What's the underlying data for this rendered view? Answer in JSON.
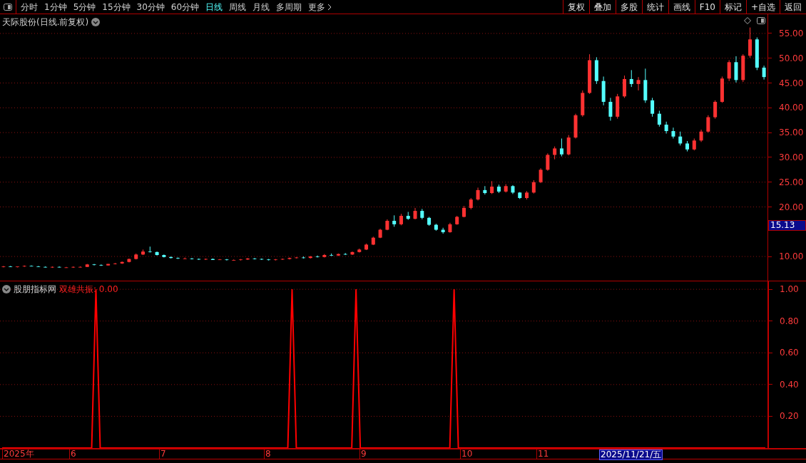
{
  "toolbar": {
    "periods": [
      {
        "label": "分时",
        "selected": false
      },
      {
        "label": "1分钟",
        "selected": false
      },
      {
        "label": "5分钟",
        "selected": false
      },
      {
        "label": "15分钟",
        "selected": false
      },
      {
        "label": "30分钟",
        "selected": false
      },
      {
        "label": "60分钟",
        "selected": false
      },
      {
        "label": "日线",
        "selected": true
      },
      {
        "label": "周线",
        "selected": false
      },
      {
        "label": "月线",
        "selected": false
      },
      {
        "label": "多周期",
        "selected": false
      }
    ],
    "more": "更多",
    "actions": [
      "复权",
      "叠加",
      "多股",
      "统计",
      "画线",
      "F10",
      "标记",
      "+自选",
      "返回"
    ]
  },
  "main_chart": {
    "title": "天际股份(日线.前复权)",
    "last_price": "15.13",
    "chart_data": {
      "type": "candlestick",
      "ylim": [
        5.13,
        58.87
      ],
      "grid": true,
      "yticks": [
        {
          "value": 55,
          "label": "55.00"
        },
        {
          "value": 50,
          "label": "50.00"
        },
        {
          "value": 45,
          "label": "45.00"
        },
        {
          "value": 40,
          "label": "40.00"
        },
        {
          "value": 35,
          "label": "35.00"
        },
        {
          "value": 30,
          "label": "30.00"
        },
        {
          "value": 25,
          "label": "25.00"
        },
        {
          "value": 20,
          "label": "20.00"
        },
        {
          "value": 10,
          "label": "10.00"
        }
      ],
      "categories": [
        null,
        null,
        null,
        null,
        null,
        null,
        null,
        null,
        null,
        null,
        null,
        null,
        null,
        null,
        null,
        null,
        null,
        null,
        null,
        null,
        null,
        null,
        null,
        null,
        null,
        null,
        null,
        null,
        null,
        null,
        null,
        null,
        null,
        null,
        null,
        null,
        null,
        null,
        null,
        null,
        null,
        null,
        null,
        null,
        null,
        null,
        null,
        null,
        null,
        null,
        null,
        null,
        null,
        null,
        null,
        null,
        null,
        null,
        null,
        null,
        null,
        null,
        null,
        null,
        null,
        null,
        null,
        null,
        null,
        null,
        null,
        null,
        null,
        null,
        null,
        null,
        null,
        null,
        null,
        null,
        null,
        null,
        null,
        null,
        null,
        null,
        null,
        null,
        null,
        null,
        null,
        null,
        null,
        null,
        null,
        null,
        null,
        null,
        null,
        null,
        null,
        null,
        null,
        null,
        null,
        null,
        null,
        null,
        null,
        null
      ],
      "ohlc": [
        [
          7.9,
          8.1,
          7.8,
          8.0
        ],
        [
          8.0,
          8.1,
          7.9,
          7.9
        ],
        [
          7.9,
          8.0,
          7.8,
          8.0
        ],
        [
          8.0,
          8.2,
          7.9,
          8.1
        ],
        [
          8.1,
          8.2,
          8.0,
          8.0
        ],
        [
          8.0,
          8.1,
          7.9,
          7.9
        ],
        [
          7.9,
          8.0,
          7.8,
          7.8
        ],
        [
          7.8,
          8.0,
          7.7,
          7.9
        ],
        [
          7.9,
          8.0,
          7.8,
          7.8
        ],
        [
          7.8,
          7.9,
          7.7,
          7.8
        ],
        [
          7.8,
          8.0,
          7.7,
          7.9
        ],
        [
          7.9,
          8.0,
          7.8,
          7.9
        ],
        [
          7.9,
          8.5,
          7.9,
          8.4
        ],
        [
          8.4,
          8.5,
          8.2,
          8.3
        ],
        [
          8.3,
          8.4,
          8.1,
          8.2
        ],
        [
          8.2,
          8.5,
          8.2,
          8.5
        ],
        [
          8.5,
          8.7,
          8.4,
          8.6
        ],
        [
          8.6,
          9.0,
          8.5,
          8.9
        ],
        [
          8.9,
          9.6,
          8.8,
          9.5
        ],
        [
          9.5,
          10.6,
          9.4,
          10.4
        ],
        [
          10.4,
          11.4,
          10.3,
          11.0
        ],
        [
          11.0,
          12.0,
          10.8,
          10.9
        ],
        [
          10.9,
          11.0,
          10.2,
          10.3
        ],
        [
          10.3,
          10.4,
          9.8,
          9.9
        ],
        [
          9.9,
          10.0,
          9.6,
          9.7
        ],
        [
          9.7,
          9.8,
          9.5,
          9.6
        ],
        [
          9.6,
          9.8,
          9.5,
          9.6
        ],
        [
          9.6,
          9.7,
          9.4,
          9.5
        ],
        [
          9.5,
          9.6,
          9.3,
          9.4
        ],
        [
          9.4,
          9.6,
          9.3,
          9.5
        ],
        [
          9.5,
          9.6,
          9.3,
          9.3
        ],
        [
          9.3,
          9.5,
          9.3,
          9.4
        ],
        [
          9.4,
          9.5,
          9.2,
          9.3
        ],
        [
          9.3,
          9.4,
          9.2,
          9.3
        ],
        [
          9.3,
          9.5,
          9.2,
          9.4
        ],
        [
          9.4,
          9.7,
          9.3,
          9.6
        ],
        [
          9.6,
          9.7,
          9.4,
          9.5
        ],
        [
          9.5,
          9.6,
          9.3,
          9.4
        ],
        [
          9.4,
          9.5,
          9.2,
          9.3
        ],
        [
          9.3,
          9.5,
          9.2,
          9.4
        ],
        [
          9.4,
          9.6,
          9.3,
          9.5
        ],
        [
          9.5,
          9.8,
          9.4,
          9.7
        ],
        [
          9.7,
          9.9,
          9.6,
          9.8
        ],
        [
          9.8,
          10.0,
          9.6,
          9.7
        ],
        [
          9.7,
          10.1,
          9.6,
          10.0
        ],
        [
          10.0,
          10.2,
          9.8,
          9.9
        ],
        [
          9.9,
          10.5,
          9.8,
          10.3
        ],
        [
          10.3,
          10.6,
          10.1,
          10.2
        ],
        [
          10.2,
          10.6,
          10.1,
          10.5
        ],
        [
          10.5,
          10.7,
          10.3,
          10.4
        ],
        [
          10.4,
          11.0,
          10.3,
          10.9
        ],
        [
          10.9,
          11.6,
          10.8,
          11.4
        ],
        [
          11.4,
          12.6,
          11.3,
          12.4
        ],
        [
          12.4,
          14.0,
          12.3,
          13.8
        ],
        [
          13.8,
          15.6,
          13.7,
          15.4
        ],
        [
          15.4,
          17.5,
          15.3,
          17.2
        ],
        [
          17.2,
          18.3,
          16.0,
          16.5
        ],
        [
          16.5,
          18.6,
          16.3,
          18.2
        ],
        [
          18.2,
          19.0,
          17.4,
          17.6
        ],
        [
          17.6,
          19.8,
          17.5,
          19.2
        ],
        [
          19.2,
          19.6,
          17.5,
          17.8
        ],
        [
          17.8,
          18.0,
          16.2,
          16.4
        ],
        [
          16.4,
          16.6,
          15.2,
          15.4
        ],
        [
          15.4,
          15.8,
          14.6,
          14.9
        ],
        [
          14.9,
          16.8,
          14.8,
          16.5
        ],
        [
          16.5,
          18.2,
          16.4,
          18.0
        ],
        [
          18.0,
          20.2,
          17.9,
          19.8
        ],
        [
          19.8,
          21.8,
          19.5,
          21.5
        ],
        [
          21.5,
          23.9,
          21.3,
          23.4
        ],
        [
          23.4,
          24.2,
          22.5,
          22.8
        ],
        [
          22.8,
          25.2,
          22.6,
          24.1
        ],
        [
          24.1,
          24.5,
          22.8,
          23.1
        ],
        [
          23.1,
          24.6,
          22.9,
          24.2
        ],
        [
          24.2,
          24.4,
          22.6,
          22.9
        ],
        [
          22.9,
          23.0,
          21.6,
          21.8
        ],
        [
          21.8,
          23.2,
          21.5,
          22.9
        ],
        [
          22.9,
          25.4,
          22.7,
          25.0
        ],
        [
          25.0,
          27.8,
          24.8,
          27.5
        ],
        [
          27.5,
          30.8,
          27.3,
          30.5
        ],
        [
          30.5,
          32.2,
          29.6,
          31.8
        ],
        [
          31.8,
          33.8,
          30.2,
          30.6
        ],
        [
          30.6,
          34.5,
          30.4,
          34.0
        ],
        [
          34.0,
          38.8,
          33.8,
          38.5
        ],
        [
          38.5,
          43.5,
          38.2,
          43.0
        ],
        [
          43.0,
          50.8,
          42.8,
          49.6
        ],
        [
          49.6,
          50.2,
          44.8,
          45.4
        ],
        [
          45.4,
          46.3,
          40.5,
          41.2
        ],
        [
          41.2,
          42.0,
          37.4,
          38.2
        ],
        [
          38.2,
          42.8,
          37.8,
          42.3
        ],
        [
          42.3,
          46.5,
          42.0,
          45.8
        ],
        [
          45.8,
          47.6,
          44.2,
          44.8
        ],
        [
          44.8,
          46.2,
          43.5,
          45.6
        ],
        [
          45.6,
          47.9,
          41.0,
          41.5
        ],
        [
          41.5,
          42.0,
          38.2,
          38.8
        ],
        [
          38.8,
          39.4,
          36.2,
          36.6
        ],
        [
          36.6,
          37.2,
          34.8,
          35.3
        ],
        [
          35.3,
          36.0,
          33.8,
          34.2
        ],
        [
          34.2,
          35.2,
          32.4,
          32.8
        ],
        [
          32.8,
          33.3,
          31.2,
          31.6
        ],
        [
          31.6,
          33.8,
          31.4,
          33.4
        ],
        [
          33.4,
          35.6,
          33.1,
          35.2
        ],
        [
          35.2,
          38.5,
          35.0,
          38.1
        ],
        [
          38.1,
          41.5,
          37.8,
          41.2
        ],
        [
          41.2,
          46.3,
          41.0,
          45.9
        ],
        [
          45.9,
          49.6,
          45.4,
          49.2
        ],
        [
          49.2,
          50.4,
          45.1,
          45.6
        ],
        [
          45.6,
          50.8,
          45.2,
          50.5
        ],
        [
          50.5,
          56.2,
          50.1,
          53.8
        ],
        [
          53.8,
          54.2,
          47.6,
          48.1
        ],
        [
          48.1,
          48.5,
          45.7,
          46.2
        ]
      ]
    }
  },
  "indicator": {
    "source": "股朋指标网",
    "reading": ": 0.00",
    "chart_data": {
      "type": "line",
      "ylim": [
        0,
        1.05
      ],
      "grid": true,
      "categories": [
        null,
        null,
        null,
        null,
        null,
        null,
        null,
        null,
        null,
        null,
        null,
        null,
        null,
        null,
        null,
        null,
        null,
        null,
        null,
        null,
        null,
        null,
        null,
        null,
        null,
        null,
        null,
        null,
        null,
        null,
        null,
        null,
        null,
        null,
        null,
        null,
        null,
        null,
        null,
        null,
        null,
        null,
        null,
        null,
        null,
        null,
        null,
        null,
        null,
        null,
        null,
        null,
        null,
        null,
        null,
        null,
        null,
        null,
        null,
        null,
        null,
        null,
        null,
        null,
        null,
        null,
        null,
        null,
        null,
        null,
        null,
        null,
        null,
        null,
        null,
        null,
        null,
        null,
        null,
        null,
        null,
        null,
        null,
        null,
        null,
        null,
        null,
        null,
        null,
        null,
        null,
        null,
        null,
        null,
        null,
        null,
        null,
        null,
        null,
        null,
        null,
        null,
        null,
        null,
        null,
        null,
        null,
        null,
        null,
        null,
        null,
        null,
        null,
        null,
        null,
        null,
        null,
        null,
        null,
        null,
        null,
        null,
        null,
        null,
        null,
        null,
        null,
        null,
        null,
        null,
        null,
        null,
        null,
        null,
        null,
        null,
        null,
        null,
        null,
        null,
        null,
        null,
        null,
        null,
        null,
        null,
        null,
        null,
        null,
        null,
        null,
        null,
        null,
        null,
        null,
        null,
        null,
        null,
        null,
        null,
        null,
        null,
        null,
        null,
        null,
        null,
        null,
        null,
        null,
        null,
        null,
        null,
        null,
        null,
        null,
        null,
        null,
        null,
        null,
        null
      ],
      "series": [
        {
          "name": "双雄共振",
          "color": "#ff0000",
          "values": [
            0,
            0,
            0,
            0,
            0,
            0,
            0,
            0,
            0,
            0,
            0,
            0,
            0,
            0,
            0,
            0,
            0,
            0,
            0,
            0,
            0,
            0,
            1,
            0,
            0,
            0,
            0,
            0,
            0,
            0,
            0,
            0,
            0,
            0,
            0,
            0,
            0,
            0,
            0,
            0,
            0,
            0,
            0,
            0,
            0,
            0,
            0,
            0,
            0,
            0,
            0,
            0,
            0,
            0,
            0,
            0,
            0,
            0,
            0,
            0,
            0,
            0,
            0,
            0,
            0,
            0,
            0,
            0,
            1,
            0,
            0,
            0,
            0,
            0,
            0,
            0,
            0,
            0,
            0,
            0,
            0,
            0,
            0,
            1,
            0,
            0,
            0,
            0,
            0,
            0,
            0,
            0,
            0,
            0,
            0,
            0,
            0,
            0,
            0,
            0,
            0,
            0,
            0,
            0,
            0,
            0,
            1,
            0,
            0,
            0,
            0,
            0,
            0,
            0,
            0,
            0,
            0,
            0,
            0,
            0,
            0,
            0,
            0,
            0,
            0,
            0,
            0,
            0,
            0,
            0,
            0,
            0,
            0,
            0,
            0,
            0,
            0,
            0,
            0,
            0,
            0,
            0,
            0,
            0,
            0,
            0,
            0,
            0,
            0,
            0,
            0,
            0,
            0,
            0,
            0,
            0,
            0,
            0,
            0,
            0,
            0,
            0,
            0,
            0,
            0,
            0,
            0,
            0,
            0,
            0,
            0,
            0,
            0,
            0,
            0,
            0,
            0,
            0,
            0,
            0
          ]
        }
      ],
      "yticks": [
        {
          "value": 1,
          "label": "1.00"
        },
        {
          "value": 0.8,
          "label": "0.80"
        },
        {
          "value": 0.6,
          "label": "0.60"
        },
        {
          "value": 0.4,
          "label": "0.40"
        },
        {
          "value": 0.2,
          "label": "0.20"
        }
      ]
    }
  },
  "date_axis": {
    "labels": [
      "2025年",
      "6",
      "7",
      "8",
      "9",
      "10",
      "11"
    ],
    "cursor_date": "2025/11/21/五"
  }
}
